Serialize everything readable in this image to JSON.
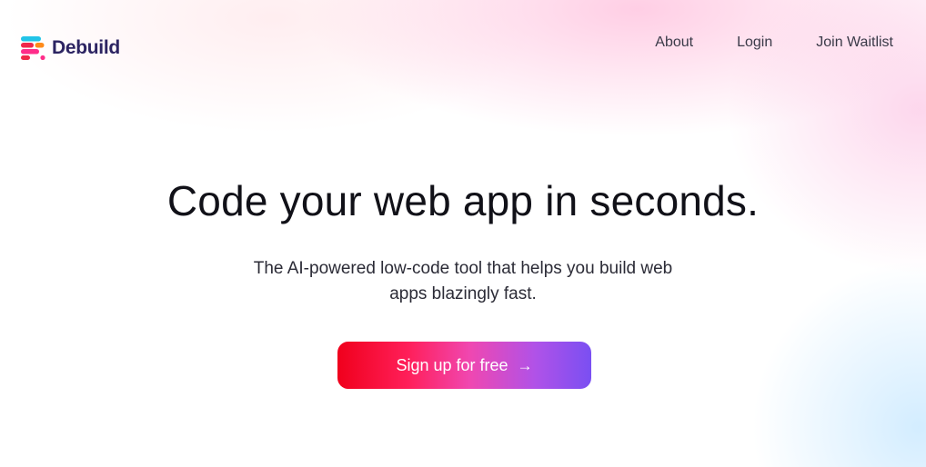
{
  "header": {
    "logo_text": "Debuild",
    "logo_icon": "debuild-logo-icon",
    "nav": {
      "about": "About",
      "login": "Login",
      "join_waitlist": "Join Waitlist"
    }
  },
  "hero": {
    "title": "Code your web app in seconds.",
    "subtitle_line1": "The AI-powered low-code tool that helps you build web",
    "subtitle_line2": "apps blazingly fast.",
    "cta_label": "Sign up for free",
    "cta_icon": "arrow-right-icon",
    "cta_arrow": "→"
  },
  "colors": {
    "brand_dark": "#2c2462",
    "logo_cyan": "#22c4e8",
    "logo_red": "#f0284a",
    "logo_orange": "#ff8a1a",
    "logo_pink": "#ff2d8a",
    "cta_start": "#f0001c",
    "cta_mid": "#f047b0",
    "cta_end": "#7a4ff2"
  }
}
